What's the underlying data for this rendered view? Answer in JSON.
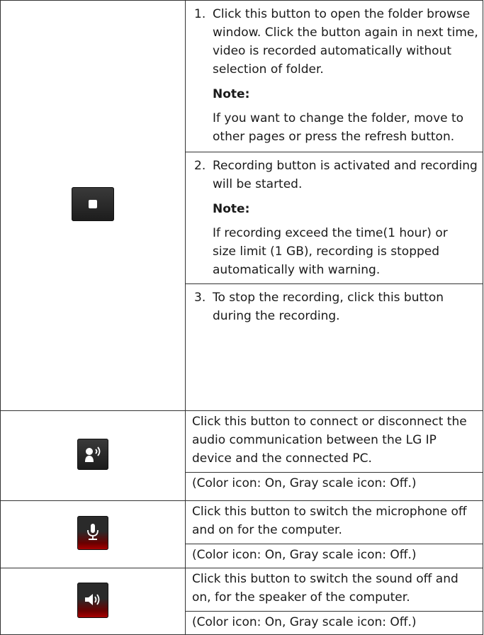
{
  "rows": [
    {
      "icon": "record-icon",
      "steps": [
        {
          "num": "1.",
          "text": "Click this button to open the folder browse window. Click the button again in next time, video is recorded automatically without selection of folder.",
          "note_label": "Note:",
          "note_text": "If you want to change the folder, move to other pages or press the refresh button."
        },
        {
          "num": "2.",
          "text": "Recording button is activated and recording will be started.",
          "note_label": "Note:",
          "note_text": "If recording exceed the time(1 hour) or size limit (1 GB), recording is stopped automatically with warning."
        },
        {
          "num": "3.",
          "text": "To stop the recording, click this button during the recording."
        }
      ]
    },
    {
      "icon": "audio-communication-icon",
      "text": "Click this button to connect or disconnect the audio communication between the LG IP device and the connected PC.",
      "status": "(Color icon: On, Gray scale icon: Off.)"
    },
    {
      "icon": "microphone-icon",
      "text": "Click this button to switch the microphone off and on for the computer.",
      "status": "(Color icon: On, Gray scale icon: Off.)"
    },
    {
      "icon": "speaker-icon",
      "text": "Click this button to switch the sound off and on, for the speaker of the computer.",
      "status": "(Color icon: On, Gray scale icon: Off.)"
    }
  ]
}
